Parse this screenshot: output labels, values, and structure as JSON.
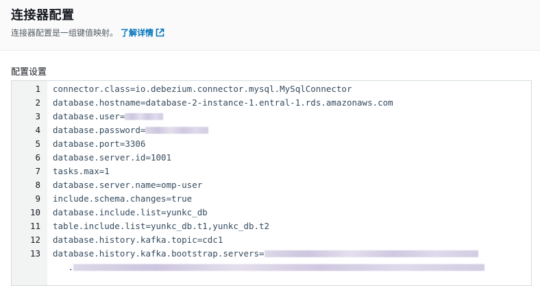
{
  "header": {
    "title": "连接器配置",
    "description": "连接器配置是一组键值映射。",
    "learn_more": "了解详情",
    "learn_more_icon": "external-link-icon"
  },
  "section": {
    "label": "配置设置"
  },
  "editor": {
    "lines": [
      {
        "num": "1",
        "prefix": "connector.class=io.debezium.connector.mysql.MySqlConnector",
        "suffix": ""
      },
      {
        "num": "2",
        "prefix": "database.hostname=database-2-instance-1.",
        "suffix": "entral-1.rds.amazonaws.com"
      },
      {
        "num": "3",
        "prefix": "database.user=",
        "suffix": ""
      },
      {
        "num": "4",
        "prefix": "database.password=",
        "suffix": ""
      },
      {
        "num": "5",
        "prefix": "database.port=3306",
        "suffix": ""
      },
      {
        "num": "6",
        "prefix": "database.server.id=1001",
        "suffix": ""
      },
      {
        "num": "7",
        "prefix": "tasks.max=1",
        "suffix": ""
      },
      {
        "num": "8",
        "prefix": "database.server.name=omp-user",
        "suffix": ""
      },
      {
        "num": "9",
        "prefix": "include.schema.changes=true",
        "suffix": ""
      },
      {
        "num": "10",
        "prefix": "database.include.list=yunkc_db",
        "suffix": ""
      },
      {
        "num": "11",
        "prefix": "table.include.list=yunkc_db.t1,yunkc_db.t2",
        "suffix": ""
      },
      {
        "num": "12",
        "prefix": "database.history.kafka.topic=cdc1",
        "suffix": ""
      },
      {
        "num": "13",
        "prefix": "database.history.kafka.bootstrap.servers=",
        "suffix": ""
      },
      {
        "num": "",
        "prefix": "   .",
        "suffix": ""
      }
    ]
  }
}
